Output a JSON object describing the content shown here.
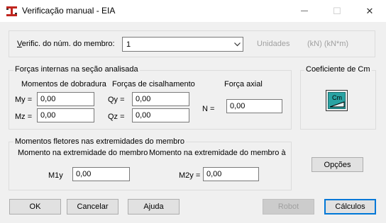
{
  "window": {
    "title": "Verificação manual - EIA",
    "minimize_glyph": "—",
    "maximize_glyph": "☐",
    "close_glyph": "✕"
  },
  "member": {
    "label": "Verific. do núm. do membro:",
    "selected": "1",
    "units_label": "Unidades",
    "units_value": "(kN) (kN*m)"
  },
  "internal_forces": {
    "group_title": "Forças internas na seção analisada",
    "bending_heading": "Momentos de dobradura",
    "shear_heading": "Forças de cisalhamento",
    "axial_heading": "Força axial",
    "My_label": "My =",
    "Mz_label": "Mz =",
    "Qy_label": "Qy =",
    "Qz_label": "Qz =",
    "N_label": "N =",
    "My": "0,00",
    "Mz": "0,00",
    "Qy": "0,00",
    "Qz": "0,00",
    "N": "0,00"
  },
  "cm": {
    "group_title": "Coeficiente de Cm",
    "icon_text": "Cm"
  },
  "end_moments": {
    "group_title": "Momentos fletores nas extremidades do membro",
    "heading1": "Momento na extremidade do membro",
    "heading2": "Momento na extremidade do membro à",
    "M1y_label": "M1y",
    "M2y_label": "M2y =",
    "M1y": "0,00",
    "M2y": "0,00"
  },
  "buttons": {
    "options": "Opções",
    "ok": "OK",
    "cancel": "Cancelar",
    "help": "Ajuda",
    "robot": "Robot",
    "calculations": "Cálculos"
  },
  "colors": {
    "accent": "#0078d7",
    "icon_bg": "#2aa3a3",
    "icon_red": "#c0251e"
  }
}
